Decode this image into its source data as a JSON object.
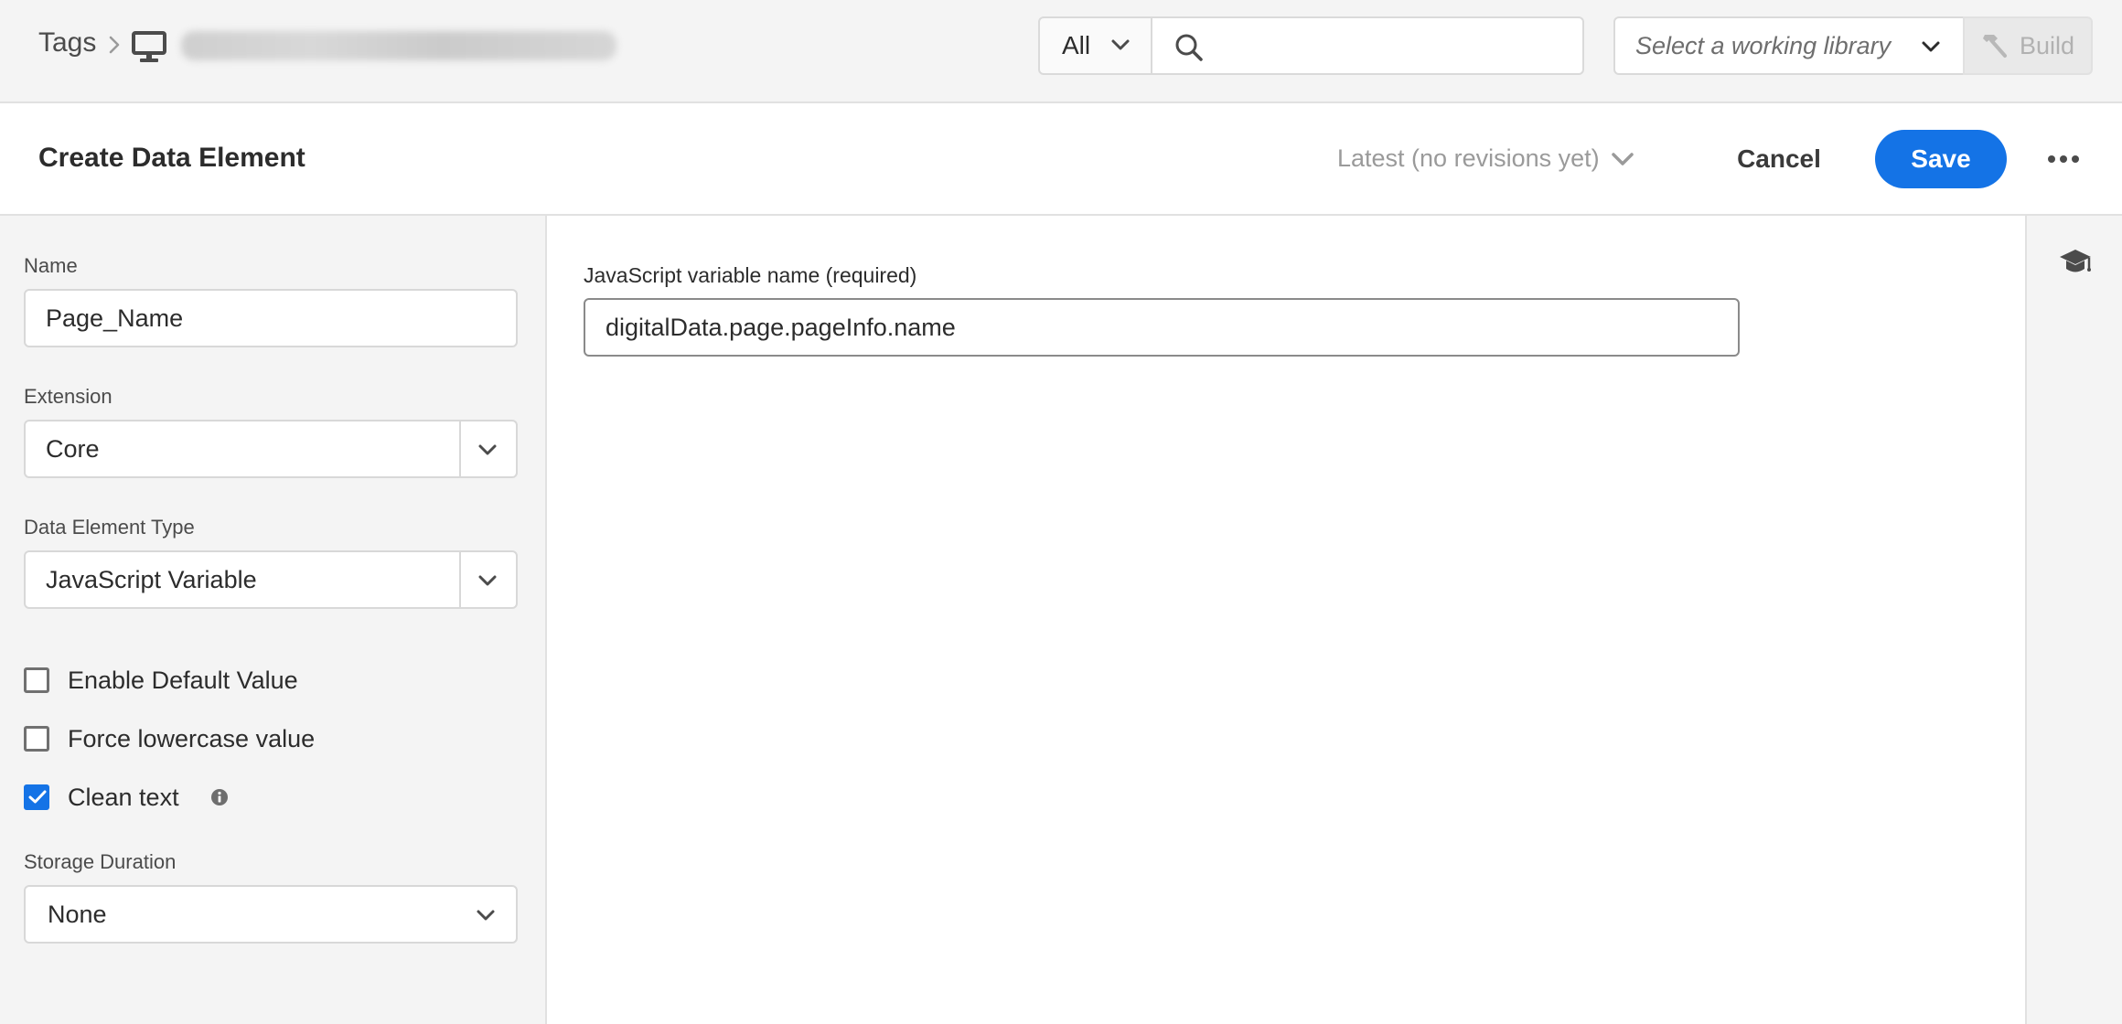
{
  "topbar": {
    "breadcrumb_root": "Tags",
    "scope_value": "All",
    "search_placeholder": "",
    "library_placeholder": "Select a working library",
    "build_label": "Build"
  },
  "header": {
    "title": "Create Data Element",
    "revision_label": "Latest (no revisions yet)",
    "cancel_label": "Cancel",
    "save_label": "Save"
  },
  "form": {
    "name_label": "Name",
    "name_value": "Page_Name",
    "extension_label": "Extension",
    "extension_value": "Core",
    "type_label": "Data Element Type",
    "type_value": "JavaScript Variable",
    "enable_default_label": "Enable Default Value",
    "force_lowercase_label": "Force lowercase value",
    "clean_text_label": "Clean text",
    "storage_label": "Storage Duration",
    "storage_value": "None"
  },
  "main": {
    "var_label": "JavaScript variable name (required)",
    "var_value": "digitalData.page.pageInfo.name"
  },
  "colors": {
    "accent": "#1473e6",
    "panel_bg": "#f4f4f4"
  },
  "icons": [
    "chevron-right-icon",
    "monitor-icon",
    "chevron-down-icon",
    "search-icon",
    "hammer-icon",
    "more-icon",
    "check-icon",
    "info-icon",
    "graduation-cap-icon"
  ]
}
